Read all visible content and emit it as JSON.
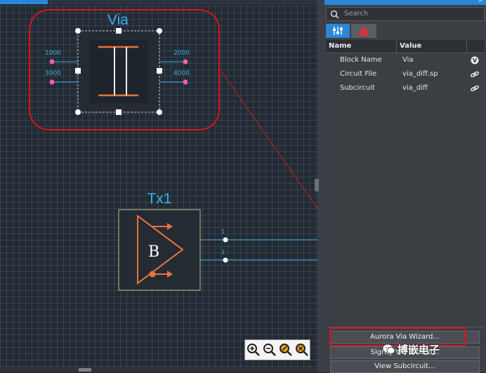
{
  "canvas": {
    "via_block": {
      "title": "Via",
      "left_pins": [
        "1000",
        "3000"
      ],
      "right_pins": [
        "2000",
        "4000"
      ]
    },
    "tx_block": {
      "title": "Tx1",
      "symbol": "B",
      "pin_numbers": [
        "1",
        "2"
      ]
    },
    "zoom_toolbar": {
      "icons": [
        "zoom-in-icon",
        "zoom-out-icon",
        "zoom-fit-icon",
        "zoom-reset-icon"
      ]
    }
  },
  "sidebar": {
    "search": {
      "placeholder": "Search"
    },
    "toolbar": {
      "buttons": [
        "properties-icon",
        "tags-icon"
      ]
    },
    "property_grid": {
      "columns": [
        "Name",
        "Value"
      ],
      "rows": [
        {
          "name": "Block Name",
          "value": "Via",
          "icon": "v-badge-icon"
        },
        {
          "name": "Circuit File",
          "value": "via_diff.sp",
          "icon": "link-icon"
        },
        {
          "name": "Subcircuit",
          "value": "via_diff",
          "icon": "link-icon"
        }
      ]
    },
    "actions": {
      "aurora": "Aurora Via Wizard...",
      "sigrity": "Sigrity Via Wizard...",
      "view_subcircuit": "View Subcircuit..."
    }
  },
  "watermark": "搏嵌电子",
  "colors": {
    "accent": "#2a86d8",
    "callout_red": "#d8161c",
    "symbol_orange": "#e8743b",
    "pin_pink": "#f060a8",
    "wire_blue": "#3aaee8",
    "title_blue": "#3ab0f0"
  }
}
